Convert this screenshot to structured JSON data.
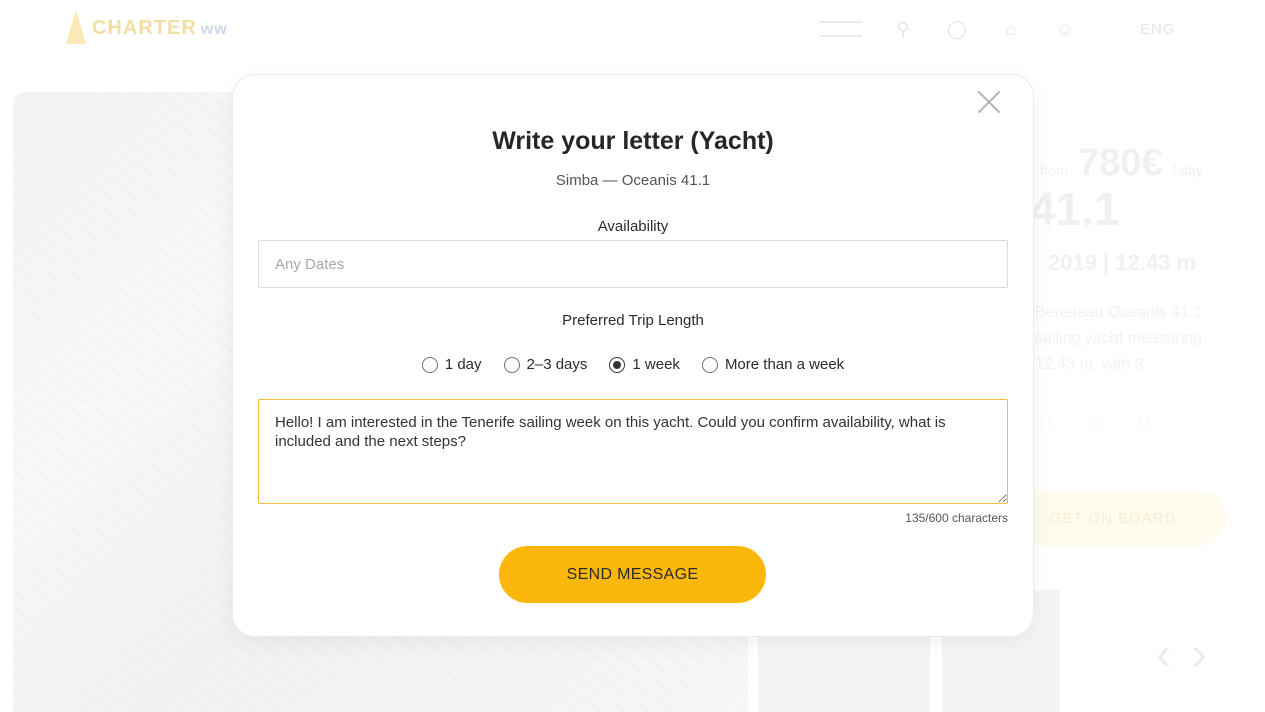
{
  "header": {
    "logo_text": "CHARTER",
    "logo_sub": "ww",
    "language": "ENG"
  },
  "listing": {
    "price_from": "from",
    "price_amount": "780€",
    "price_per": "/ day",
    "model_fragment": "41.1",
    "specs": "2019 | 12.43 m",
    "description": "Beneteau Oceanis 41.1 sailing yacht measuring 12.43 m, with 3",
    "cta_label": "GET ON BOARD"
  },
  "modal": {
    "title": "Write your letter (Yacht)",
    "subtitle": "Simba — Oceanis 41.1",
    "availability_label": "Availability",
    "dates_placeholder": "Any Dates",
    "dates_value": "",
    "trip_length_label": "Preferred Trip Length",
    "trip_options": [
      {
        "label": "1 day",
        "checked": false
      },
      {
        "label": "2–3 days",
        "checked": false
      },
      {
        "label": "1 week",
        "checked": true
      },
      {
        "label": "More than a week",
        "checked": false
      }
    ],
    "message_text": "Hello! I am interested in the Tenerife sailing week on this yacht. Could you confirm availability, what is included and the next steps?",
    "char_counter": "135/600 characters",
    "send_label": "SEND MESSAGE"
  },
  "colors": {
    "accent": "#fbb80a",
    "textarea_border": "#f2bf3d"
  }
}
